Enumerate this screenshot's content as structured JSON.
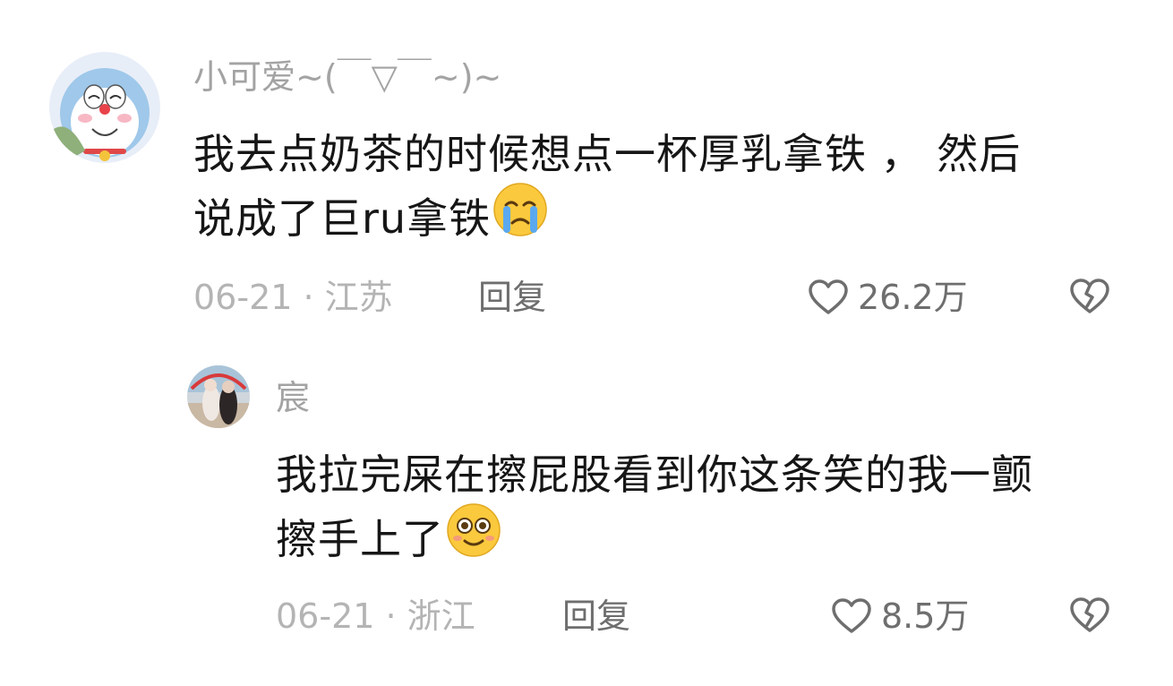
{
  "comments": [
    {
      "username": "小可爱~(￣▽￣~)~",
      "text_line1": "我去点奶茶的时候想点一杯厚乳拿铁 ， 然后",
      "text_line2": "说成了巨ru拿铁",
      "emoji": "crying-face",
      "meta": "06-21 · 江苏",
      "reply_label": "回复",
      "likes": "26.2万"
    },
    {
      "username": "宸",
      "text_line1": "我拉完屎在擦屁股看到你这条笑的我一颤",
      "text_line2": "擦手上了",
      "emoji": "smiling-face",
      "meta": "06-21 · 浙江",
      "reply_label": "回复",
      "likes": "8.5万"
    }
  ]
}
